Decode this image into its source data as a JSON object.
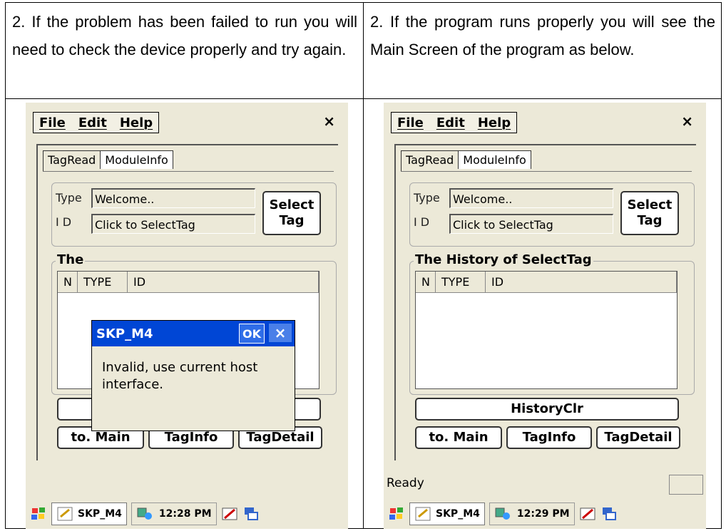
{
  "doc": {
    "left_text": "2. If the problem has been failed to run you will need to check the device properly and try again.",
    "right_text": "2. If the program runs properly you will see the Main Screen of the program as below."
  },
  "app": {
    "menu": [
      "File",
      "Edit",
      "Help"
    ],
    "close": "×",
    "tabs": [
      "TagRead",
      "ModuleInfo"
    ],
    "type_label": "Type",
    "id_label": "I D",
    "type_value": "Welcome..",
    "id_value": "Click to SelectTag",
    "select_btn": "Select Tag",
    "history_title": "The History of SelectTag",
    "columns": [
      "N",
      "TYPE",
      "ID"
    ],
    "history_clr": "HistoryClr",
    "to_main": "to. Main",
    "tag_info": "TagInfo",
    "tag_detail": "TagDetail"
  },
  "left_screen": {
    "status": "",
    "task_app": "SKP_M4",
    "time": "12:28 PM",
    "dialog": {
      "title": "SKP_M4",
      "ok": "OK",
      "close": "×",
      "message": "Invalid, use current host interface."
    },
    "group_title_visible": "The"
  },
  "right_screen": {
    "status": "Ready",
    "task_app": "SKP_M4",
    "time": "12:29 PM"
  },
  "colors": {
    "dialog_title": "#0046d5",
    "window_bg": "#ece9d8"
  }
}
